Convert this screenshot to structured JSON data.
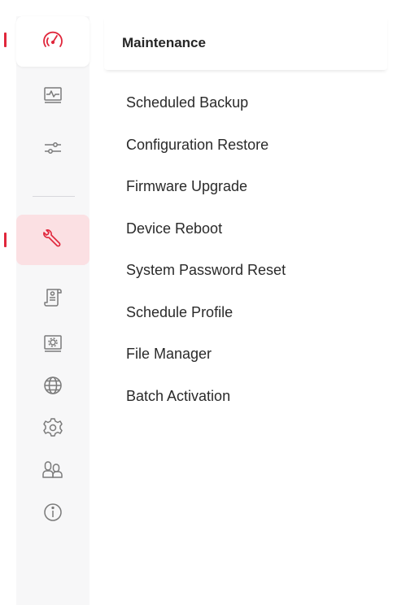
{
  "sidebar": {
    "items": [
      {
        "icon": "dashboard-gauge-icon"
      },
      {
        "icon": "monitor-activity-icon"
      },
      {
        "icon": "sliders-icon"
      },
      {
        "icon": "wrench-icon"
      },
      {
        "icon": "document-scroll-icon"
      },
      {
        "icon": "system-settings-icon"
      },
      {
        "icon": "globe-icon"
      },
      {
        "icon": "gear-icon"
      },
      {
        "icon": "users-icon"
      },
      {
        "icon": "info-icon"
      }
    ],
    "accent_color": "#e0263b"
  },
  "panel": {
    "title": "Maintenance",
    "items": [
      {
        "label": "Scheduled Backup"
      },
      {
        "label": "Configuration Restore"
      },
      {
        "label": "Firmware Upgrade"
      },
      {
        "label": "Device Reboot"
      },
      {
        "label": "System Password Reset"
      },
      {
        "label": "Schedule Profile"
      },
      {
        "label": "File Manager"
      },
      {
        "label": "Batch Activation"
      }
    ]
  }
}
